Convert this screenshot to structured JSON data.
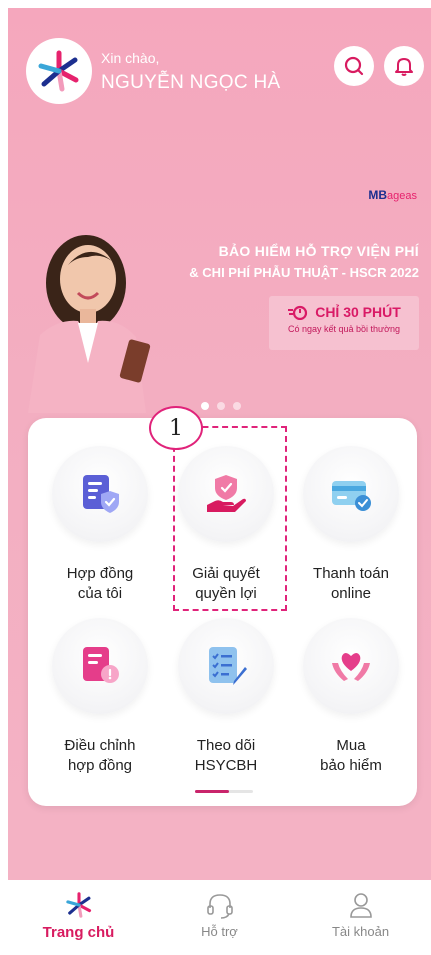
{
  "header": {
    "greeting": "Xin chào,",
    "user_name": "NGUYỄN NGỌC HÀ",
    "search_icon": "search-icon",
    "bell_icon": "bell-icon"
  },
  "banner": {
    "brand": "MB",
    "brand_suffix": "ageas",
    "line1": "BẢO HIỂM HỖ TRỢ VIỆN PHÍ",
    "line2": "& CHI PHÍ PHẪU THUẬT - HSCR 2022",
    "highlight": "CHỈ 30 PHÚT",
    "highlight_sub": "Có ngay kết quả bồi thường",
    "slide_count": 3,
    "active_slide": 0
  },
  "menu": {
    "items": [
      {
        "line1": "Hợp đồng",
        "line2": "của tôi",
        "icon": "contract-shield-icon"
      },
      {
        "line1": "Giải quyết",
        "line2": "quyền lợi",
        "icon": "claim-hand-shield-icon"
      },
      {
        "line1": "Thanh toán",
        "line2": "online",
        "icon": "card-payment-icon"
      },
      {
        "line1": "Điều chỉnh",
        "line2": "hợp đồng",
        "icon": "contract-adjust-icon"
      },
      {
        "line1": "Theo dõi",
        "line2": "HSYCBH",
        "icon": "checklist-pen-icon"
      },
      {
        "line1": "Mua",
        "line2": "bảo hiểm",
        "icon": "heart-hands-icon"
      }
    ],
    "callout_number": "1"
  },
  "nav": {
    "home": "Trang chủ",
    "support": "Hỗ trợ",
    "account": "Tài khoản"
  },
  "colors": {
    "accent": "#d81b60",
    "background": "#f4b0c3",
    "highlight_border": "#e0237a"
  }
}
